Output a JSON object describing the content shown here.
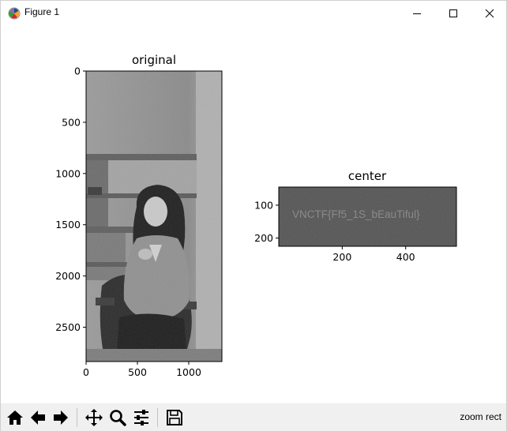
{
  "window": {
    "title": "Figure 1",
    "icon": "matplotlib-icon"
  },
  "controls": {
    "minimize_icon": "minimize-icon",
    "maximize_icon": "maximize-icon",
    "close_icon": "close-icon"
  },
  "figure": {
    "ax1": {
      "title": "original",
      "image_text": "",
      "xticks": [
        "0",
        "500",
        "1000"
      ],
      "yticks": [
        "0",
        "500",
        "1000",
        "1500",
        "2000",
        "2500"
      ],
      "xlim": [
        0,
        1323
      ],
      "ylim": [
        2835,
        0
      ],
      "x_tick_values": [
        0,
        500,
        1000
      ],
      "y_tick_values": [
        0,
        500,
        1000,
        1500,
        2000,
        2500
      ]
    },
    "ax2": {
      "title": "center",
      "image_text": "VNCTF{Ff5_1S_bEauTiful}",
      "xticks": [
        "200",
        "400"
      ],
      "yticks": [
        "100",
        "200"
      ],
      "xlim": [
        0,
        560
      ],
      "ylim": [
        225,
        45
      ],
      "x_tick_values": [
        200,
        400
      ],
      "y_tick_values": [
        100,
        200
      ]
    }
  },
  "toolbar": {
    "home_icon": "home-icon",
    "back_icon": "back-arrow-icon",
    "forward_icon": "forward-arrow-icon",
    "pan_icon": "pan-icon",
    "zoom_icon": "zoom-icon",
    "configure_icon": "configure-subplots-icon",
    "save_icon": "save-icon"
  },
  "status": {
    "mode": "zoom rect"
  },
  "colors": {
    "axes_frame": "#000000",
    "toolbar_bg": "#f0f0f0",
    "photo_dark": "#2a2a2a",
    "photo_mid": "#8c8c8c",
    "spectrum_bg": "#545454",
    "spectrum_text": "#8a8a8a"
  }
}
